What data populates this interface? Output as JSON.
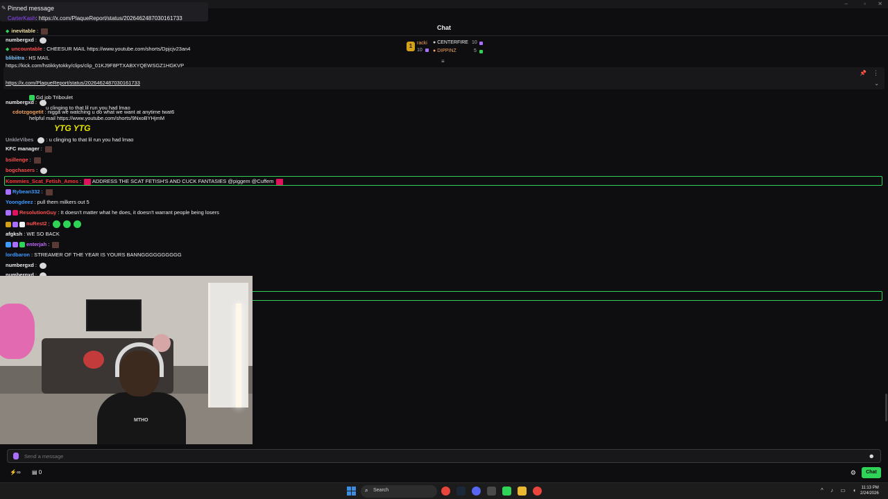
{
  "pinned": {
    "title": "Pinned message",
    "user": "CarterKash",
    "text": "https://x.com/PlaqueReport/status/2026462487030161733"
  },
  "chat": {
    "title": "Chat"
  },
  "leaderboard": {
    "rank": "1",
    "entries": [
      {
        "name": "racki",
        "count": "10"
      },
      {
        "name": "CENTERFIRE",
        "count": "10"
      },
      {
        "name": "DIPPINZ",
        "count": "5"
      }
    ]
  },
  "messages": [
    {
      "user": "inevitable",
      "text": ""
    },
    {
      "user": "numbergxd",
      "text": ""
    },
    {
      "user": "uncountable",
      "text": "CHEESUR MAIL https://www.youtube.com/shorts/Dpjcjv23an4"
    },
    {
      "user": "blibiitra",
      "text": "HS MAIL"
    },
    {
      "user": "",
      "text": "https://kick.com/hstikkytokky/clips/clip_01KJ9F8PTXABXYQEWSGZ1HGKVP"
    },
    {
      "user": "",
      "text": "https://x.com/PlaqueReport/status/2026462487030161733"
    },
    {
      "user": "numbergxd",
      "text": ""
    },
    {
      "user": "cdotzgogetit",
      "text": "nigga we watching u do what we want at anytime twat6"
    },
    {
      "user": "",
      "text": "u clinging to that lil run you had lmao"
    },
    {
      "user": "",
      "text": "Gd job Triboulet"
    },
    {
      "user": "",
      "text": "helpful mail https://www.youtube.com/shorts/9NxoBYHjmM"
    },
    {
      "user": "",
      "text": "YTG YTG"
    },
    {
      "user": "",
      "text": "u clinging to that lil run you had lmao"
    },
    {
      "user": "KFC manager",
      "text": ""
    },
    {
      "user": "Kommies_Scat_Fetish_Amos",
      "text": "ADDRESS THE SCAT FETISH'S AND CUCK FANTASIES @piggem @Cuffem"
    },
    {
      "user": "Rybean332",
      "text": ""
    },
    {
      "user": "Yoongdeez",
      "text": "pull them milkers out 5"
    },
    {
      "user": "",
      "text": "It doesn't matter what he does, it doesn't warrant people being losers"
    },
    {
      "user": "afgksh",
      "text": "WE SO BACK"
    },
    {
      "user": "enterjah",
      "text": ""
    },
    {
      "user": "lordbaron",
      "text": "STREAMER OF THE YEAR IS YOURS BANNGGGGGGGGGG"
    },
    {
      "user": "numbergxd",
      "text": ""
    },
    {
      "user": "numbergxd",
      "text": ""
    }
  ],
  "webcam": {
    "shirt": "MTHO"
  },
  "input": {
    "placeholder": "Send a message"
  },
  "bottombar": {
    "points": "∞",
    "count": "0",
    "chat_button": "Chat"
  },
  "taskbar": {
    "search": "Search",
    "time": "11:13 PM",
    "date": "2/24/2026"
  },
  "colors": {
    "accent": "#2fd357",
    "purple": "#9147ff",
    "bg": "#0e0e10"
  }
}
